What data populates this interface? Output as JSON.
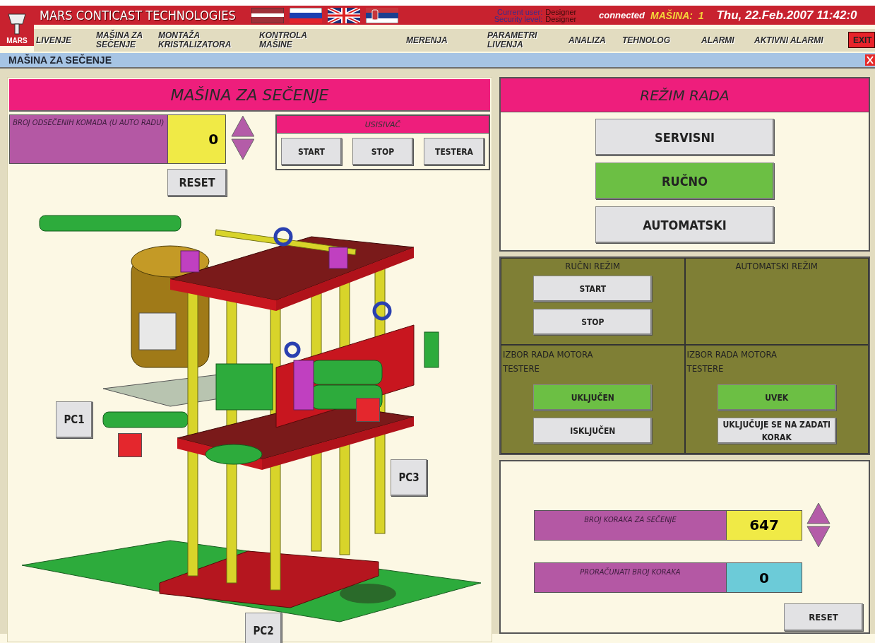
{
  "header": {
    "logo": "MARS",
    "title": "MARS CONTICAST TECHNOLOGIES",
    "user_label": "Current user:",
    "user": "Designer",
    "security_label": "Security level:",
    "security": "Designer",
    "connection": "connected",
    "machine_label": "MAŠINA:",
    "machine": "1",
    "datetime": "Thu, 22.Feb.2007 11:42:0"
  },
  "menu": [
    {
      "label": "LIVENJE"
    },
    {
      "label": "MAŠINA ZA\nSEČENJE"
    },
    {
      "label": "MONTAŽA\nKRISTALIZATORA"
    },
    {
      "label": "KONTROLA\nMAŠINE"
    },
    {
      "label": "MERENJA"
    },
    {
      "label": "PARAMETRI\nLIVENJA"
    },
    {
      "label": "ANALIZA"
    },
    {
      "label": "TEHNOLOG"
    },
    {
      "label": "ALARMI"
    },
    {
      "label": "AKTIVNI ALARMI"
    }
  ],
  "exit": "EXIT",
  "page_title": "MAŠINA ZA SEČENJE",
  "machine_panel": {
    "title": "MAŠINA ZA SEČENJE",
    "counter": {
      "label": "BROJ ODSEČENIH KOMADA (U AUTO RADU)",
      "value": "0"
    },
    "reset": "RESET",
    "usisivac": {
      "title": "USISIVAČ",
      "buttons": [
        "START",
        "STOP",
        "TESTERA"
      ]
    },
    "sensors": [
      {
        "label": "PC1"
      },
      {
        "label": "PC3"
      },
      {
        "label": "PC2"
      }
    ]
  },
  "mode_panel": {
    "title": "REŽIM RADA",
    "options": [
      {
        "label": "SERVISNI",
        "selected": false
      },
      {
        "label": "RUČNO",
        "selected": true
      },
      {
        "label": "AUTOMATSKI",
        "selected": false
      }
    ]
  },
  "manual": {
    "title": "RUČNI REŽIM",
    "buttons": [
      "START",
      "STOP"
    ]
  },
  "automatic": {
    "title": "AUTOMATSKI REŽIM"
  },
  "motor_manual": {
    "title": "IZBOR RADA MOTORA\nTESTERE",
    "options": [
      {
        "label": "UKLJUČEN",
        "selected": true
      },
      {
        "label": "ISKLJUČEN",
        "selected": false
      }
    ]
  },
  "motor_auto": {
    "title": "IZBOR RADA MOTORA\nTESTERE",
    "options": [
      {
        "label": "UVEK",
        "selected": true
      },
      {
        "label": "UKLJUČUJE SE NA ZADATI KORAK",
        "selected": false
      }
    ]
  },
  "steps": {
    "label": "BROJ KORAKA ZA SEČENJE",
    "value": "647"
  },
  "calculated": {
    "label": "PRORAČUNATI BROJ KORAKA",
    "value": "0"
  },
  "steps_reset": "RESET"
}
